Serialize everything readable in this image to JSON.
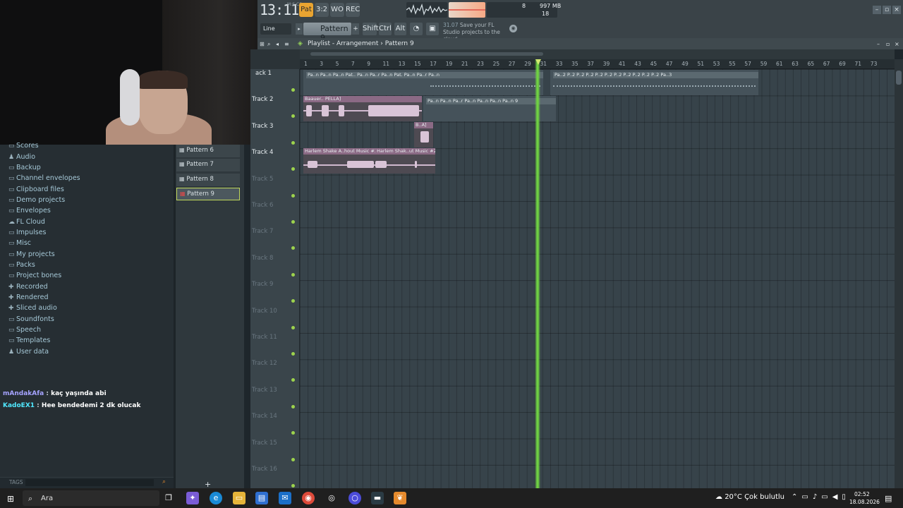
{
  "toolbar": {
    "time": "13:11",
    "time_sub": "M:S:CS",
    "buttons": [
      "Pat",
      "3:2",
      "WO",
      "REC"
    ],
    "cpu": "8",
    "memory": "997 MB",
    "polyphony": "18",
    "snap": "Line",
    "pattern": "Pattern 9",
    "keys": [
      "Shift",
      "Ctrl",
      "Alt"
    ],
    "news_time": "31.07",
    "news_text": "Save your FL Studio projects to the cloud"
  },
  "browser": {
    "items": [
      {
        "label": "Scores",
        "icon": "folder-icon"
      },
      {
        "label": "Audio",
        "icon": "person-icon"
      },
      {
        "label": "Backup",
        "icon": "folder-open-icon"
      },
      {
        "label": "Channel envelopes",
        "icon": "folder-icon"
      },
      {
        "label": "Clipboard files",
        "icon": "folder-icon"
      },
      {
        "label": "Demo projects",
        "icon": "folder-icon"
      },
      {
        "label": "Envelopes",
        "icon": "folder-icon"
      },
      {
        "label": "FL Cloud",
        "icon": "cloud-icon"
      },
      {
        "label": "Impulses",
        "icon": "folder-icon"
      },
      {
        "label": "Misc",
        "icon": "folder-icon"
      },
      {
        "label": "My projects",
        "icon": "folder-icon"
      },
      {
        "label": "Packs",
        "icon": "folder-icon"
      },
      {
        "label": "Project bones",
        "icon": "folder-icon"
      },
      {
        "label": "Recorded",
        "icon": "plus-icon"
      },
      {
        "label": "Rendered",
        "icon": "plus-icon"
      },
      {
        "label": "Sliced audio",
        "icon": "plus-icon"
      },
      {
        "label": "Soundfonts",
        "icon": "folder-icon"
      },
      {
        "label": "Speech",
        "icon": "folder-icon"
      },
      {
        "label": "Templates",
        "icon": "folder-icon"
      },
      {
        "label": "User data",
        "icon": "person-icon"
      }
    ],
    "tags_label": "TAGS"
  },
  "chat": [
    {
      "user": "mAndakAfa",
      "text": "kaç yaşında abi"
    },
    {
      "user": "KadoEX1",
      "text": "Hee bendedemi 2 dk olucak"
    }
  ],
  "picker": {
    "patterns": [
      "Pattern 6",
      "Pattern 7",
      "Pattern 8",
      "Pattern 9"
    ],
    "selected": "Pattern 9"
  },
  "playlist": {
    "title": "Playlist - Arrangement",
    "breadcrumb_sep": "›",
    "pattern": "Pattern 9",
    "bars": [
      "1",
      "3",
      "5",
      "7",
      "9",
      "11",
      "13",
      "15",
      "17",
      "19",
      "21",
      "23",
      "25",
      "27",
      "29",
      "31",
      "33",
      "35",
      "37",
      "39",
      "41",
      "43",
      "45",
      "47",
      "49",
      "51",
      "53",
      "55",
      "57",
      "59",
      "61",
      "63",
      "65",
      "67",
      "69",
      "71",
      "73"
    ],
    "tracks": [
      "ack 1",
      "Track 2",
      "Track 3",
      "Track 4",
      "Track 5",
      "Track 6",
      "Track 7",
      "Track 8",
      "Track 9",
      "Track 10",
      "Track 11",
      "Track 12",
      "Track 13",
      "Track 14",
      "Track 15",
      "Track 16"
    ],
    "clip_labels": {
      "track1": "Pa..n Pa..n Pa..n Pat.. Pa..n Pa..r Pa..n Pat. Pa..n Pa..r Pa..n",
      "track1b": "Pa..2 P..2 P..2 P..2 P..2 P..2 P..2 P..2 P..2 P..2 P..2 Pa..3",
      "track2": "Baauer.. PELLA]",
      "track2b": "Pa..n Pa..n Pa..r Pa..n Pa..n Pa..n Pa..n 9",
      "track3": "B..A]",
      "track4a": "Harlem Shake A..hout Music #2",
      "track4b": "Harlem Shak..ut Music #2"
    }
  },
  "taskbar": {
    "search": "Ara",
    "weather": "20°C  Çok bulutlu",
    "time": "02:52",
    "date": "18.08.2026"
  }
}
